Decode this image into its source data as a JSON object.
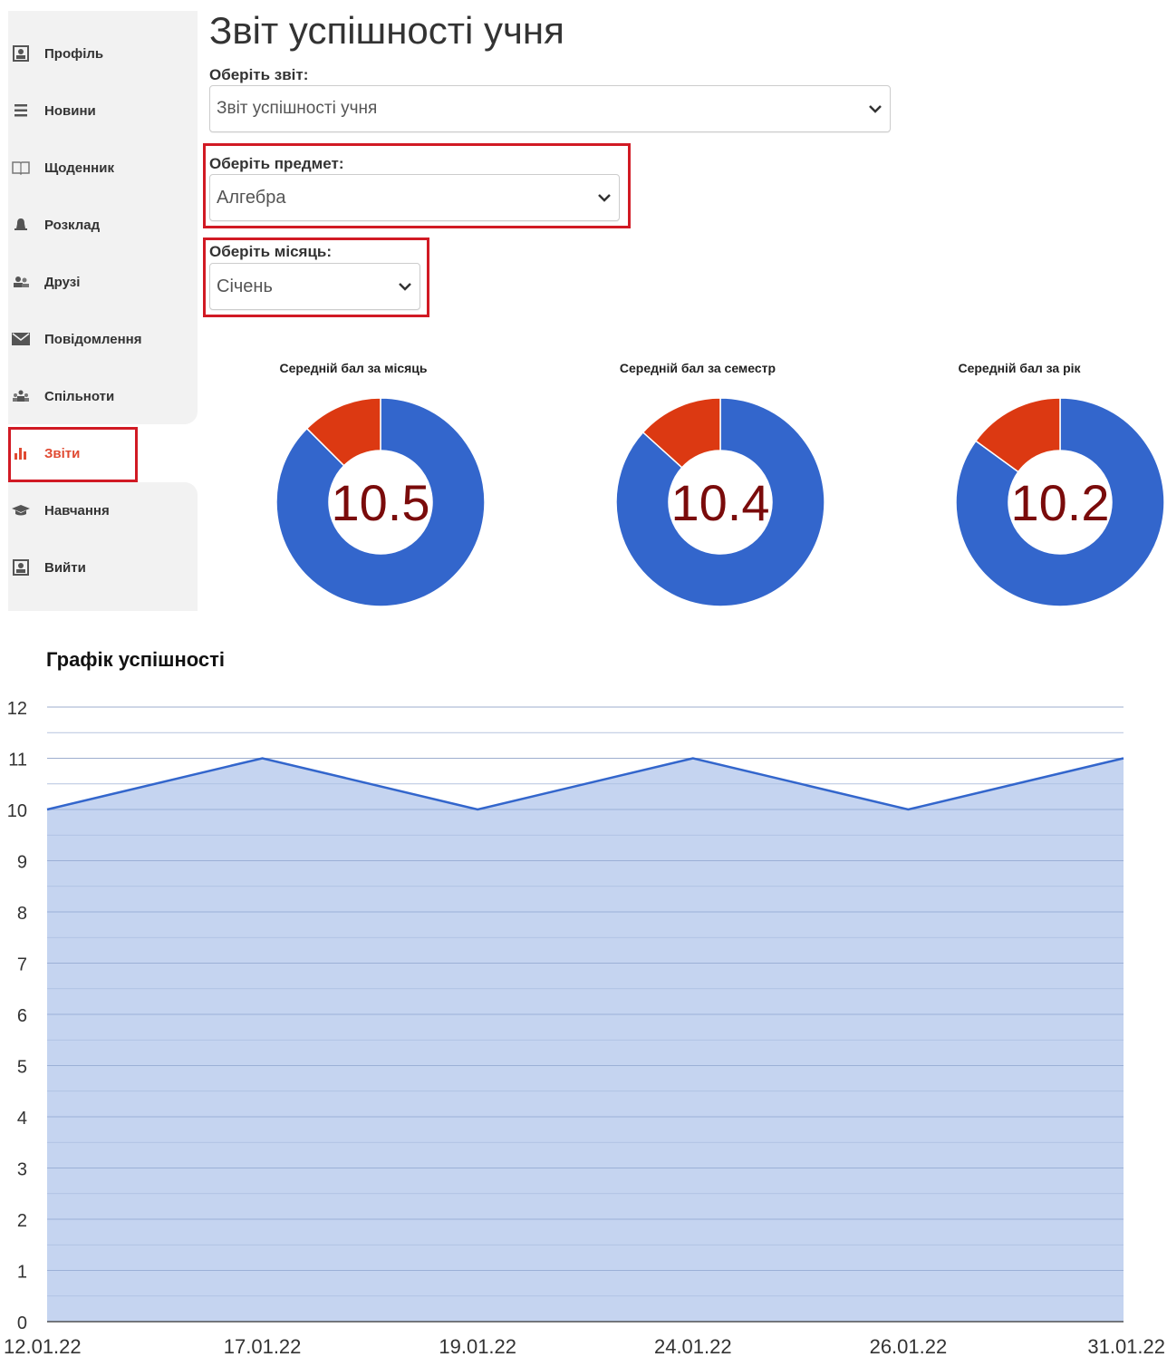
{
  "sidebar": {
    "items": [
      {
        "label": "Профіль",
        "icon": "profile-card-icon",
        "active": false
      },
      {
        "label": "Новини",
        "icon": "list-icon",
        "active": false
      },
      {
        "label": "Щоденник",
        "icon": "book-icon",
        "active": false
      },
      {
        "label": "Розклад",
        "icon": "bell-icon",
        "active": false
      },
      {
        "label": "Друзі",
        "icon": "users-icon",
        "active": false
      },
      {
        "label": "Повідомлення",
        "icon": "envelope-icon",
        "active": false
      },
      {
        "label": "Спільноти",
        "icon": "group-icon",
        "active": false
      },
      {
        "label": "Звіти",
        "icon": "bar-chart-icon",
        "active": true
      },
      {
        "label": "Навчання",
        "icon": "graduation-cap-icon",
        "active": false
      },
      {
        "label": "Вийти",
        "icon": "profile-card-icon",
        "active": false
      }
    ]
  },
  "header": {
    "title": "Звіт успішності учня"
  },
  "filters": {
    "report": {
      "label": "Оберіть звіт:",
      "value": "Звіт успішності учня"
    },
    "subject": {
      "label": "Оберіть предмет:",
      "value": "Алгебра"
    },
    "month": {
      "label": "Оберіть місяць:",
      "value": "Січень"
    }
  },
  "colors": {
    "accent": "#d11a24",
    "active_text": "#e04a32",
    "donut_main": "#3366cc",
    "donut_rest": "#dc3912",
    "area_fill": "#c2d2ef",
    "line": "#3366cc",
    "donut_value": "#7a0b0b"
  },
  "donuts": [
    {
      "title": "Середній бал за місяць",
      "value": "10.5",
      "share": 0.875
    },
    {
      "title": "Середній бал за семестр",
      "value": "10.4",
      "share": 0.867
    },
    {
      "title": "Середній бал за рік",
      "value": "10.2",
      "share": 0.85
    }
  ],
  "chart_data": {
    "type": "area",
    "title": "Графік успішності",
    "x": [
      "12.01.22",
      "17.01.22",
      "19.01.22",
      "24.01.22",
      "26.01.22",
      "31.01.22"
    ],
    "series": [
      {
        "values": [
          10,
          11,
          10,
          11,
          10,
          11
        ]
      }
    ],
    "ylim": [
      0,
      12
    ],
    "yticks": [
      0,
      1,
      2,
      3,
      4,
      5,
      6,
      7,
      8,
      9,
      10,
      11,
      12
    ],
    "grid": true
  }
}
